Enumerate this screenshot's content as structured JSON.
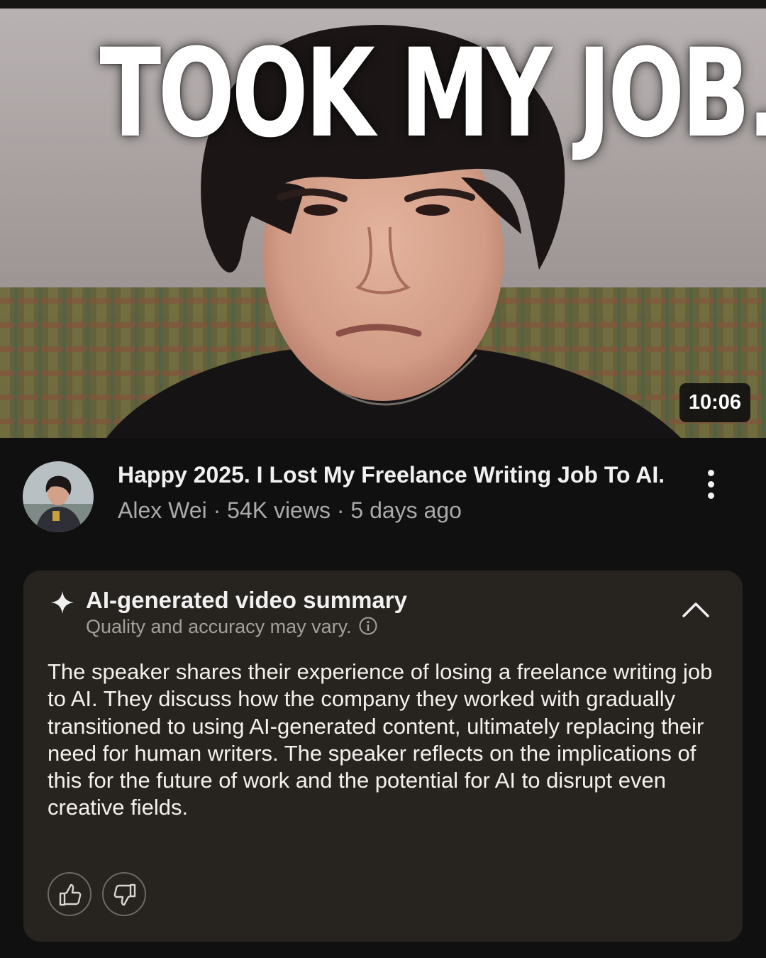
{
  "video": {
    "thumbnail_text": "TOOK MY JOB.",
    "duration": "10:06",
    "title": "Happy 2025. I Lost My Freelance Writing Job To AI.",
    "meta": "Alex Wei · 54K views · 5 days ago",
    "channel": "Alex Wei",
    "views": "54K views",
    "age": "5 days ago"
  },
  "summary": {
    "title": "AI-generated video summary",
    "subtitle": "Quality and accuracy may vary.",
    "body": "The speaker shares their experience of losing a freelance writing job to AI. They discuss how the company they worked with gradually transitioned to using AI-generated content, ultimately replacing their need for human writers. The speaker reflects on the implications of this for the future of work and the potential for AI to disrupt even creative fields."
  },
  "icons": {
    "more": "more-vertical-icon",
    "sparkle": "sparkle-icon",
    "info": "info-icon",
    "collapse": "chevron-up-icon",
    "like": "thumbs-up-icon",
    "dislike": "thumbs-down-icon"
  },
  "colors": {
    "page_bg": "#111010",
    "card_bg": "#27231f",
    "secondary_text": "#aaaaaa"
  }
}
